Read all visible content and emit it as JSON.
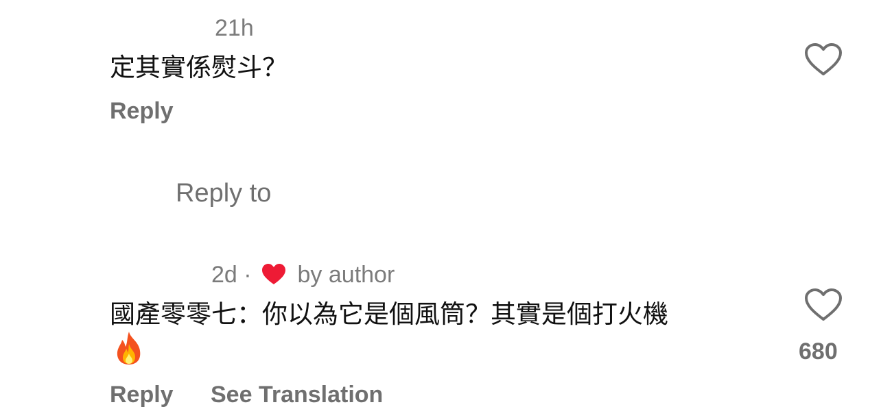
{
  "comment1": {
    "time": "21h",
    "text": "定其實係熨斗？",
    "reply_label": "Reply"
  },
  "reply_to": {
    "label": "Reply to"
  },
  "comment2": {
    "time": "2d",
    "separator": "·",
    "liked_by_author": "by author",
    "text": "國產零零七：你以為它是個風筒？其實是個打火機",
    "emoji": "🔥",
    "like_count": "680",
    "reply_label": "Reply",
    "translation_label": "See Translation"
  },
  "colors": {
    "author_heart": "#ee1b35",
    "muted_text": "#6f6f6f"
  }
}
